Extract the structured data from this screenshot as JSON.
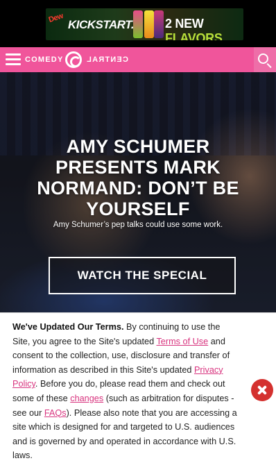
{
  "ad": {
    "brand_top": "Dew",
    "brand_name": "KICKSTART.",
    "flavors_number": "2 NEW",
    "flavors_word": "FLAVORS"
  },
  "header": {
    "logo_left": "COMEDY",
    "logo_right": "CENTRAL"
  },
  "hero": {
    "title": "AMY SCHUMER PRESENTS MARK NORMAND: DON’T BE YOURSELF",
    "subtitle": "Amy Schumer’s pep talks could use some work.",
    "watch_label": "WATCH THE SPECIAL"
  },
  "terms": {
    "heading": "We've Updated Our Terms.",
    "text_1": " By continuing to use the Site, you agree to the Site's updated ",
    "link_terms": "Terms of Use",
    "text_2": " and consent to the collection, use, disclosure and transfer of information as described in this Site's updated ",
    "link_privacy": "Privacy Policy",
    "text_3": ". Before you do, please read them and check out some of these ",
    "link_changes": "changes",
    "text_4": " (such as arbitration for disputes - see our ",
    "link_faqs": "FAQs",
    "text_5": "). Please also note that you are accessing a site which is designed for and targeted to U.S. audiences and is governed by and operated in accordance with U.S. laws."
  },
  "colors": {
    "brand_pink": "#f0559b",
    "link_pink": "#d8337e",
    "close_red": "#d4312f"
  },
  "icons": {
    "menu": "hamburger-icon",
    "search": "search-icon",
    "close": "close-icon",
    "logo": "comedy-central-logo"
  }
}
